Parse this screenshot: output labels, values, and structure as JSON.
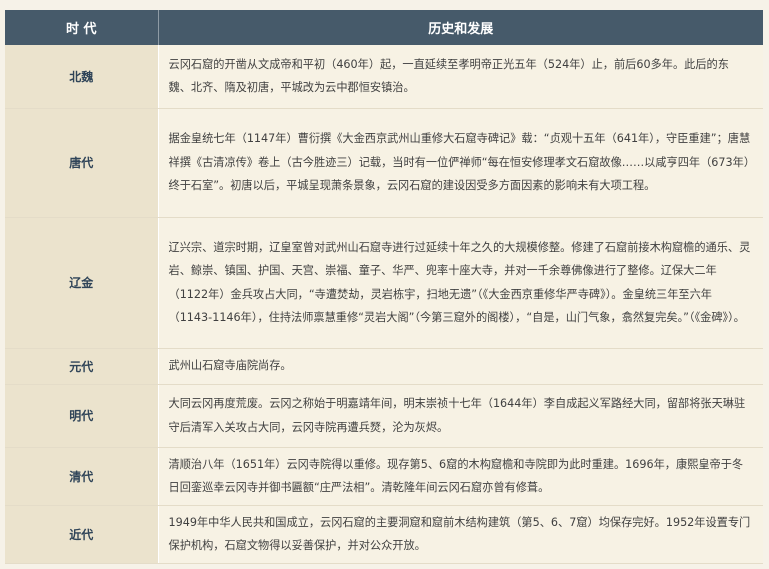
{
  "header": {
    "era": "时 代",
    "history": "历史和发展"
  },
  "rows": [
    {
      "era": "北魏",
      "text": "云冈石窟的开凿从文成帝和平初（460年）起，一直延续至孝明帝正光五年（524年）止，前后60多年。此后的东魏、北齐、隋及初唐，平城改为云中郡恒安镇治。"
    },
    {
      "era": "唐代",
      "text": "据金皇统七年（1147年）曹衍撰《大金西京武州山重修大石窟寺碑记》载：“贞观十五年（641年），守臣重建”；唐慧祥撰《古清凉传》卷上（古今胜迹三）记载，当时有一位俨禅师“每在恒安修理孝文石窟故像……以咸亨四年（673年）终于石室”。初唐以后，平城呈现萧条景象，云冈石窟的建设因受多方面因素的影响未有大项工程。"
    },
    {
      "era": "辽金",
      "text": "辽兴宗、道宗时期，辽皇室曾对武州山石窟寺进行过延续十年之久的大规模修整。修建了石窟前接木构窟檐的通乐、灵岩、鲸崇、镇国、护国、天宫、崇福、童子、华严、兜率十座大寺，并对一千余尊佛像进行了整修。辽保大二年（1122年）金兵攻占大同，“寺遭焚劫，灵岩栋宇，扫地无遗”（《大金西京重修华严寺碑》）。金皇统三年至六年（1143-1146年），住持法师禀慧重修“灵岩大阁”（今第三窟外的阁楼），“自是，山门气象，翕然复完矣。”（《金碑》）。"
    },
    {
      "era": "元代",
      "text": "武州山石窟寺庙院尚存。"
    },
    {
      "era": "明代",
      "text": "大同云冈再度荒废。云冈之称始于明嘉靖年间，明末崇祯十七年（1644年）李自成起义军路经大同，留部将张天琳驻守后清军入关攻占大同，云冈寺院再遭兵燹，沦为灰烬。"
    },
    {
      "era": "清代",
      "text": "清顺治八年（1651年）云冈寺院得以重修。现存第5、6窟的木构窟檐和寺院即为此时重建。1696年，康熙皇帝于冬日回銮巡幸云冈寺并御书匾额“庄严法相”。清乾隆年间云冈石窟亦曾有修葺。"
    },
    {
      "era": "近代",
      "text": "1949年中华人民共和国成立，云冈石窟的主要洞窟和窟前木结构建筑（第5、6、7窟）均保存完好。1952年设置专门保护机构，石窟文物得以妥善保护，并对公众开放。"
    }
  ]
}
